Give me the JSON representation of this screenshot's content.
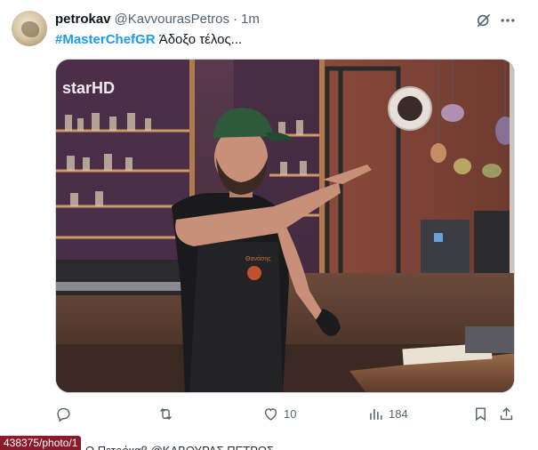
{
  "tweet": {
    "display_name": "petrokav",
    "handle": "@KavvourasPetros",
    "separator": "·",
    "time": "1m",
    "hashtag": "#MasterChefGR",
    "text": " Άδοξο τέλος...",
    "media": {
      "broadcaster_logo": "starHD",
      "apron_text": "Θανάσης"
    },
    "actions": {
      "reply_count": "",
      "retweet_count": "",
      "like_count": "10",
      "views_count": "184"
    }
  },
  "status_url": "438375/photo/1",
  "next_tweet_peek": "Ο Πετρόκαβ   @ΚΑΒΟΥΡΑΣ ΠΕΤΡΟΣ",
  "colors": {
    "accent": "#1d9bf0",
    "secondary_text": "#536471",
    "url_badge": "#8b1a2a"
  },
  "icons": [
    "grok-icon",
    "more-icon",
    "reply-icon",
    "retweet-icon",
    "like-icon",
    "views-icon",
    "bookmark-icon",
    "share-icon"
  ]
}
